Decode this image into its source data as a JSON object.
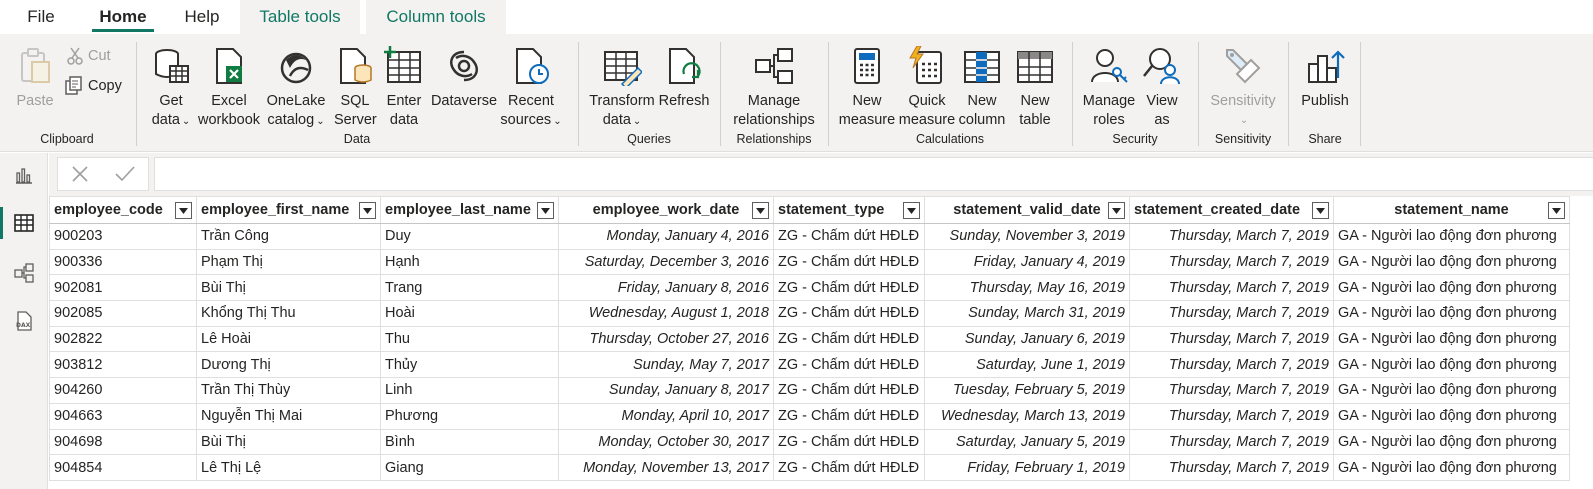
{
  "menu": {
    "tabs": [
      {
        "label": "File"
      },
      {
        "label": "Home"
      },
      {
        "label": "Help"
      },
      {
        "label": "Table tools"
      },
      {
        "label": "Column tools"
      }
    ]
  },
  "ribbon": {
    "clipboard": {
      "group_label": "Clipboard",
      "paste": "Paste",
      "cut": "Cut",
      "copy": "Copy"
    },
    "data": {
      "group_label": "Data",
      "get_data": [
        "Get",
        "data"
      ],
      "excel": [
        "Excel",
        "workbook"
      ],
      "onelake": [
        "OneLake",
        "catalog"
      ],
      "sql": [
        "SQL",
        "Server"
      ],
      "enter": [
        "Enter",
        "data"
      ],
      "dataverse": [
        "Dataverse"
      ],
      "recent": [
        "Recent",
        "sources"
      ]
    },
    "queries": {
      "group_label": "Queries",
      "transform": [
        "Transform",
        "data"
      ],
      "refresh": [
        "Refresh"
      ]
    },
    "relationships": {
      "group_label": "Relationships",
      "manage": [
        "Manage",
        "relationships"
      ]
    },
    "calculations": {
      "group_label": "Calculations",
      "new_measure": [
        "New",
        "measure"
      ],
      "quick_measure": [
        "Quick",
        "measure"
      ],
      "new_column": [
        "New",
        "column"
      ],
      "new_table": [
        "New",
        "table"
      ]
    },
    "security": {
      "group_label": "Security",
      "manage_roles": [
        "Manage",
        "roles"
      ],
      "view_as": [
        "View",
        "as"
      ]
    },
    "sensitivity": {
      "group_label": "Sensitivity",
      "sensitivity": [
        "Sensitivity"
      ]
    },
    "share": {
      "group_label": "Share",
      "publish": [
        "Publish"
      ]
    }
  },
  "colors": {
    "accent": "#117865",
    "ribbon_bg": "#f3f2f1",
    "grid_border": "#e1dfdd"
  },
  "table": {
    "columns": [
      "employee_code",
      "employee_first_name",
      "employee_last_name",
      "employee_work_date",
      "statement_type",
      "statement_valid_date",
      "statement_created_date",
      "statement_name"
    ],
    "rows": [
      [
        "900203",
        "Trần Công",
        "Duy",
        "Monday, January 4, 2016",
        "ZG - Chấm dứt HĐLĐ",
        "Sunday, November 3, 2019",
        "Thursday, March 7, 2019",
        "GA - Người lao động đơn phương"
      ],
      [
        "900336",
        "Phạm Thị",
        "Hạnh",
        "Saturday, December 3, 2016",
        "ZG - Chấm dứt HĐLĐ",
        "Friday, January 4, 2019",
        "Thursday, March 7, 2019",
        "GA - Người lao động đơn phương"
      ],
      [
        "902081",
        "Bùi Thị",
        "Trang",
        "Friday, January 8, 2016",
        "ZG - Chấm dứt HĐLĐ",
        "Thursday, May 16, 2019",
        "Thursday, March 7, 2019",
        "GA - Người lao động đơn phương"
      ],
      [
        "902085",
        "Khổng Thị Thu",
        "Hoài",
        "Wednesday, August 1, 2018",
        "ZG - Chấm dứt HĐLĐ",
        "Sunday, March 31, 2019",
        "Thursday, March 7, 2019",
        "GA - Người lao động đơn phương"
      ],
      [
        "902822",
        "Lê Hoài",
        "Thu",
        "Thursday, October 27, 2016",
        "ZG - Chấm dứt HĐLĐ",
        "Sunday, January 6, 2019",
        "Thursday, March 7, 2019",
        "GA - Người lao động đơn phương"
      ],
      [
        "903812",
        "Dương Thị",
        "Thủy",
        "Sunday, May 7, 2017",
        "ZG - Chấm dứt HĐLĐ",
        "Saturday, June 1, 2019",
        "Thursday, March 7, 2019",
        "GA - Người lao động đơn phương"
      ],
      [
        "904260",
        "Trần Thị Thùy",
        "Linh",
        "Sunday, January 8, 2017",
        "ZG - Chấm dứt HĐLĐ",
        "Tuesday, February 5, 2019",
        "Thursday, March 7, 2019",
        "GA - Người lao động đơn phương"
      ],
      [
        "904663",
        "Nguyễn Thị Mai",
        "Phương",
        "Monday, April 10, 2017",
        "ZG - Chấm dứt HĐLĐ",
        "Wednesday, March 13, 2019",
        "Thursday, March 7, 2019",
        "GA - Người lao động đơn phương"
      ],
      [
        "904698",
        "Bùi Thị",
        "Bình",
        "Monday, October 30, 2017",
        "ZG - Chấm dứt HĐLĐ",
        "Saturday, January 5, 2019",
        "Thursday, March 7, 2019",
        "GA - Người lao động đơn phương"
      ],
      [
        "904854",
        "Lê Thị Lệ",
        "Giang",
        "Monday, November 13, 2017",
        "ZG - Chấm dứt HĐLĐ",
        "Friday, February 1, 2019",
        "Thursday, March 7, 2019",
        "GA - Người lao động đơn phương"
      ]
    ]
  }
}
